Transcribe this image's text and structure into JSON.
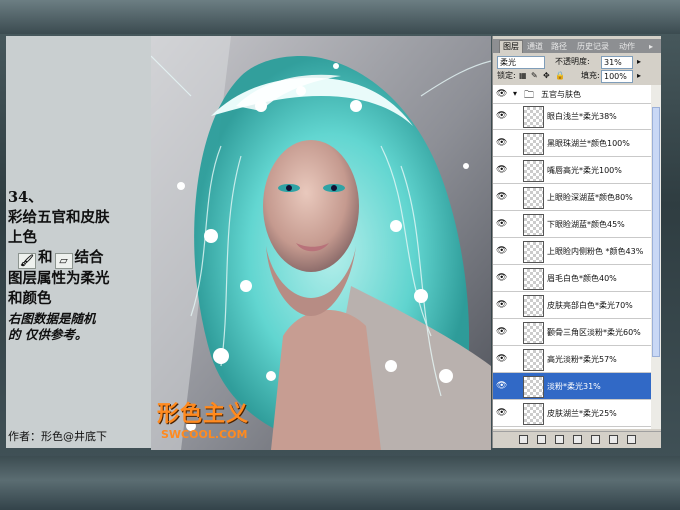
{
  "instructions": {
    "line1": "34、",
    "line2": "彩给五官和皮肤",
    "line3": "上色",
    "tool_and": "和",
    "tool_combine": "结合",
    "line5": "图层属性为柔光",
    "line6": "和颜色",
    "note_line1": "右图数据是随机",
    "note_line2": "的 仅供参考。",
    "brush_tool_icon": "brush-icon",
    "eraser_tool_icon": "eraser-icon"
  },
  "author": "作者：形色@井底下",
  "watermark": {
    "logo_text": "形色主义",
    "site": "SWCOOL.COM"
  },
  "panel": {
    "tabs": [
      "图层",
      "通道",
      "路径",
      "历史记录",
      "动作"
    ],
    "active_tab": "图层",
    "blend_mode": "柔光",
    "opacity_label": "不透明度:",
    "opacity_value": "31%",
    "lock_label": "锁定:",
    "fill_label": "填充:",
    "fill_value": "100%",
    "group_name": "五官与肤色",
    "layers": [
      {
        "name": "眼白浅兰*柔光38%",
        "selected": false
      },
      {
        "name": "黑眼珠湖兰*颜色100%",
        "selected": false
      },
      {
        "name": "嘴唇高光*柔光100%",
        "selected": false
      },
      {
        "name": "上眼睑深湖蓝*颜色80%",
        "selected": false
      },
      {
        "name": "下眼睑湖蓝*颜色45%",
        "selected": false
      },
      {
        "name": "上眼睑内侧粉色 *颜色43%",
        "selected": false
      },
      {
        "name": "眉毛白色*颜色40%",
        "selected": false
      },
      {
        "name": "皮肤亮部白色*柔光70%",
        "selected": false
      },
      {
        "name": "颧骨三角区淡粉*柔光60%",
        "selected": false
      },
      {
        "name": "高光淡粉*柔光57%",
        "selected": false
      },
      {
        "name": "淡粉*柔光31%",
        "selected": true
      },
      {
        "name": "皮肤湖兰*柔光25%",
        "selected": false
      }
    ],
    "colors": {
      "selection": "#3169c6",
      "panel_bg": "#d4d0c8",
      "hair": "#5fd9d3"
    }
  }
}
